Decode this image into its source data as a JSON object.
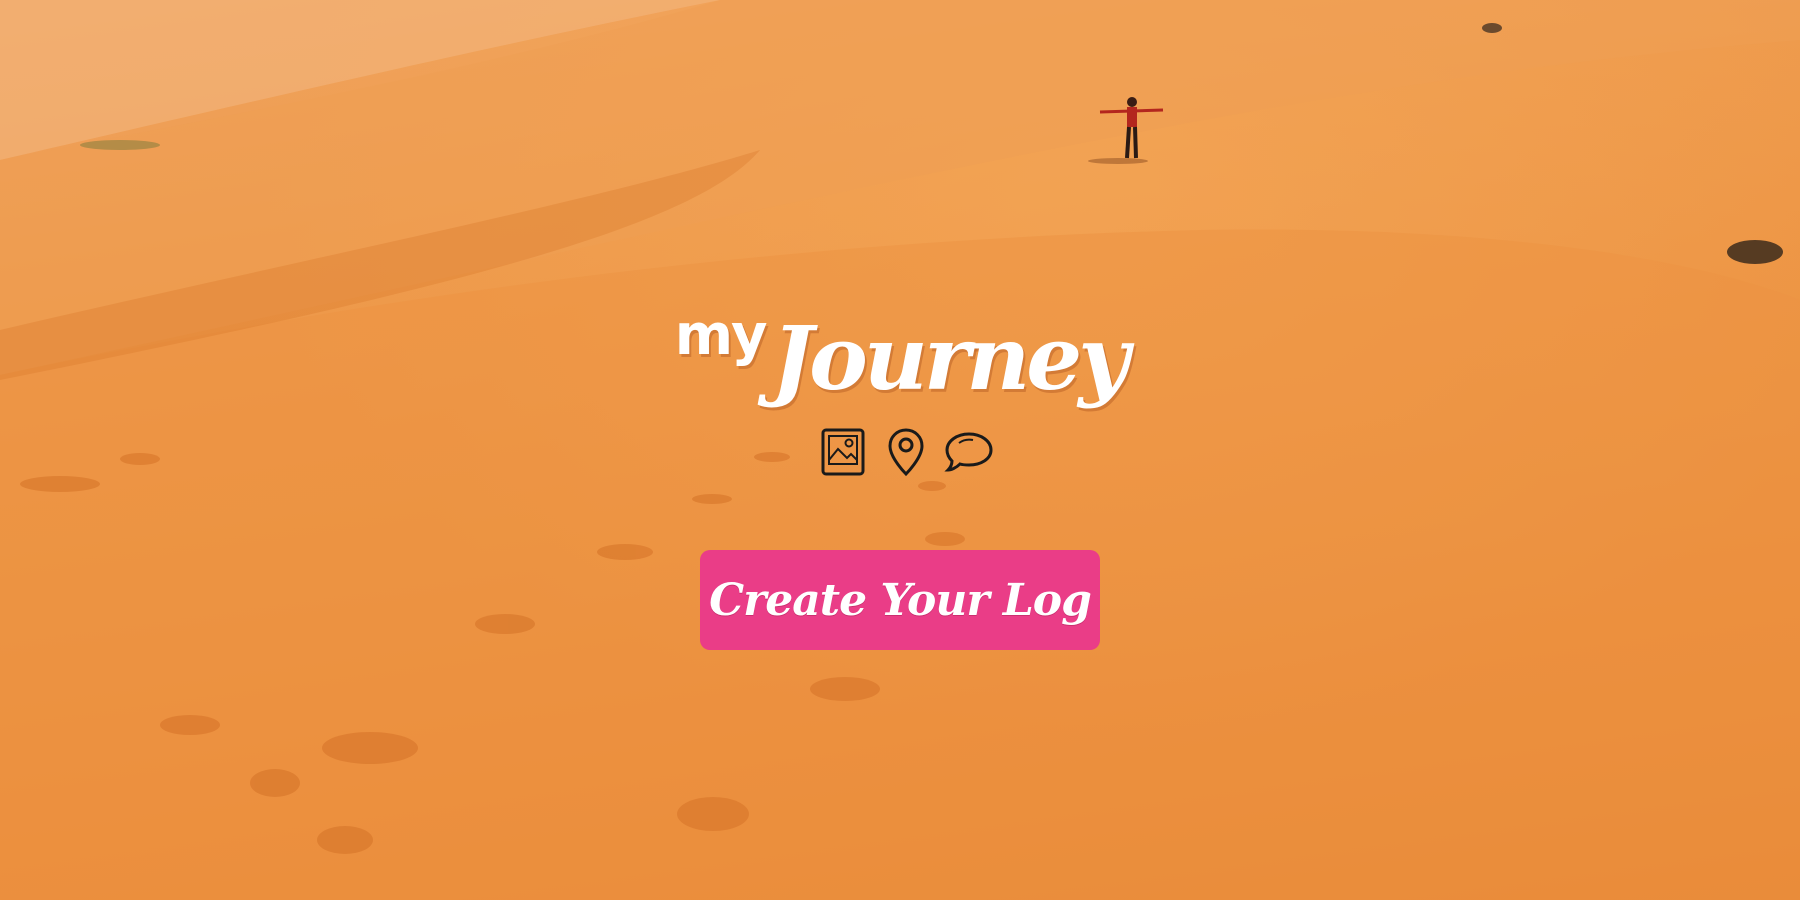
{
  "page": {
    "background_description_colors": {
      "sand_light": "#f0a460",
      "sand_mid": "#ec9240",
      "sand_dark": "#e5832f",
      "accent": "#ea3d87"
    }
  },
  "logo": {
    "small_text": "my",
    "big_text": "Journey"
  },
  "features": {
    "icons": [
      "image-icon",
      "map-pin-icon",
      "chat-bubble-icon"
    ]
  },
  "cta": {
    "label": "Create Your Log"
  }
}
